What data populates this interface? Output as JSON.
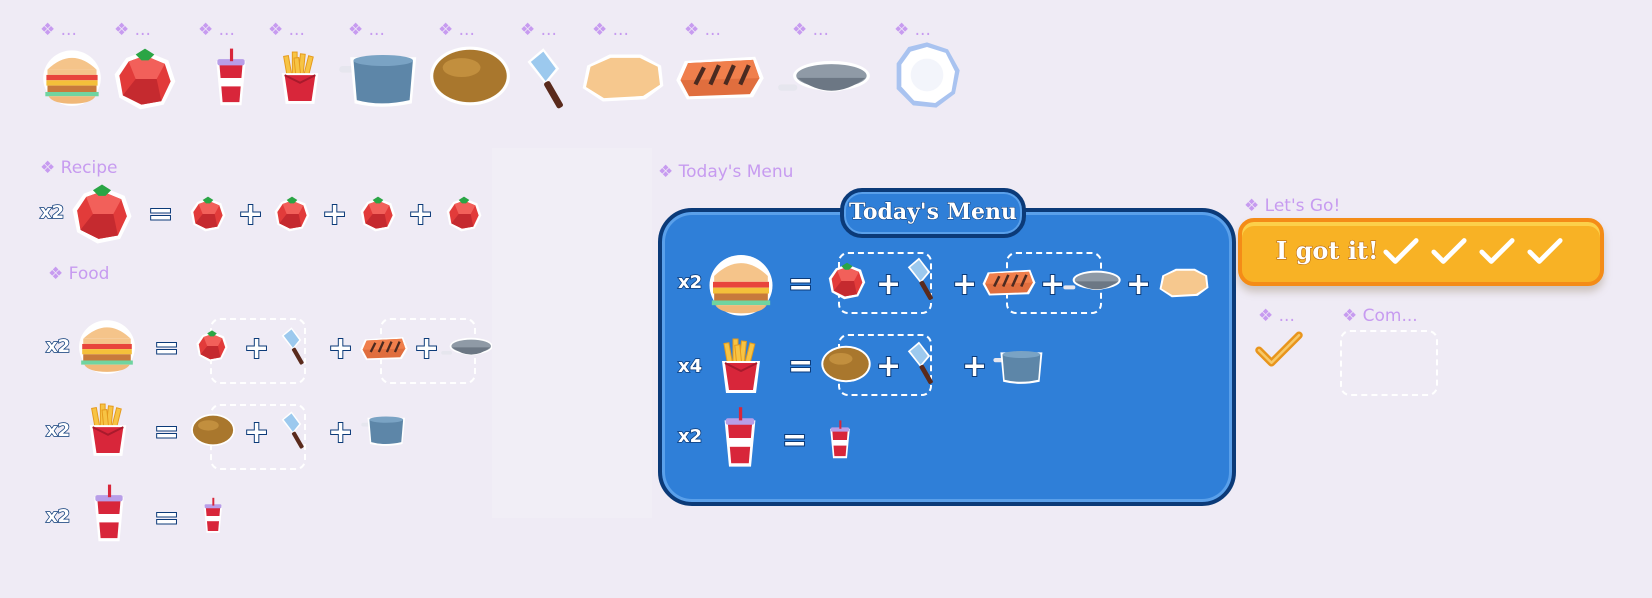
{
  "labels": {
    "asset_dots": "❖ ...",
    "recipe": "❖ Recipe",
    "food": "❖ Food",
    "todays_menu": "❖ Today's Menu",
    "lets_go": "❖ Let's Go!",
    "check_dots": "❖ ...",
    "com": "❖ Com..."
  },
  "assets": [
    "burger-icon",
    "tomato-icon",
    "soda-cup-icon",
    "fries-icon",
    "pot-icon",
    "potato-icon",
    "cleaver-icon",
    "bun-icon",
    "patty-icon",
    "frying-pan-icon",
    "plate-icon"
  ],
  "recipe": {
    "multiplier": "x2",
    "equals": "=",
    "plus": "+"
  },
  "food_rows": [
    {
      "multiplier": "x2",
      "result": "burger-icon"
    },
    {
      "multiplier": "x2",
      "result": "fries-icon"
    },
    {
      "multiplier": "x2",
      "result": "soda-cup-icon"
    }
  ],
  "menu": {
    "title": "Today's Menu",
    "rows": [
      {
        "multiplier": "x2",
        "result": "burger-icon"
      },
      {
        "multiplier": "x4",
        "result": "fries-icon"
      },
      {
        "multiplier": "x2",
        "result": "soda-cup-icon"
      }
    ]
  },
  "button": {
    "label": "I got it!",
    "checkmarks": 4
  },
  "colors": {
    "background": "#efebf5",
    "panel": "#2f7fd8",
    "panel_border": "#0b3a78",
    "button": "#f8b225",
    "button_border": "#f48c17",
    "label": "#c79bf0"
  }
}
